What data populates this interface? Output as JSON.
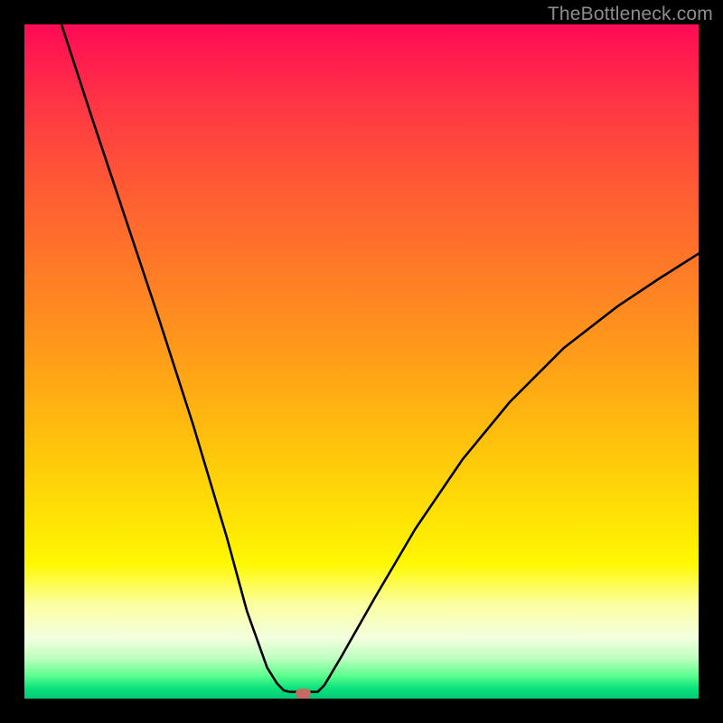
{
  "watermark": "TheBottleneck.com",
  "marker": {
    "x_frac": 0.413,
    "y_frac": 0.993
  },
  "chart_data": {
    "type": "line",
    "title": "",
    "xlabel": "",
    "ylabel": "",
    "xlim": [
      0,
      1
    ],
    "ylim": [
      0,
      1
    ],
    "series": [
      {
        "name": "left-branch",
        "x": [
          0.055,
          0.1,
          0.15,
          0.2,
          0.25,
          0.3,
          0.33,
          0.36,
          0.375,
          0.385,
          0.393
        ],
        "y": [
          1.0,
          0.862,
          0.712,
          0.562,
          0.407,
          0.24,
          0.13,
          0.046,
          0.022,
          0.012,
          0.01
        ]
      },
      {
        "name": "flat-bottom",
        "x": [
          0.393,
          0.435
        ],
        "y": [
          0.01,
          0.01
        ]
      },
      {
        "name": "right-branch",
        "x": [
          0.435,
          0.445,
          0.47,
          0.52,
          0.58,
          0.65,
          0.72,
          0.8,
          0.88,
          0.94,
          1.0
        ],
        "y": [
          0.01,
          0.02,
          0.062,
          0.15,
          0.252,
          0.355,
          0.44,
          0.52,
          0.582,
          0.622,
          0.66
        ]
      }
    ],
    "gradient_stops": [
      {
        "pos": 0.0,
        "color": "#ff0a57"
      },
      {
        "pos": 0.24,
        "color": "#ff5a34"
      },
      {
        "pos": 0.52,
        "color": "#ffa516"
      },
      {
        "pos": 0.8,
        "color": "#fff803"
      },
      {
        "pos": 0.96,
        "color": "#60ff90"
      },
      {
        "pos": 1.0,
        "color": "#04c877"
      }
    ]
  }
}
